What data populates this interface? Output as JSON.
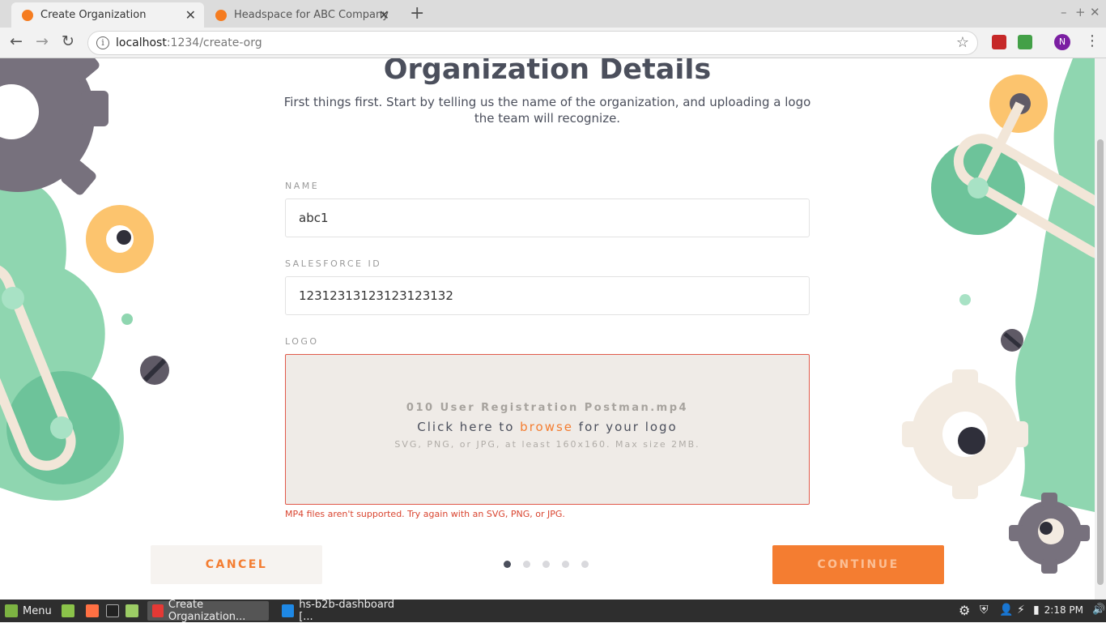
{
  "browser": {
    "tabs": [
      {
        "label": "Create Organization",
        "active": true
      },
      {
        "label": "Headspace for ABC Company",
        "active": false
      }
    ],
    "url_host": "localhost",
    "url_path": ":1234/create-org",
    "profile_initial": "N"
  },
  "page": {
    "title": "Organization Details",
    "subtitle": "First things first. Start by telling us the name of the organization, and uploading a logo the team will recognize.",
    "name_label": "NAME",
    "name_value": "abc1",
    "salesforce_label": "SALESFORCE ID",
    "salesforce_value": "12312313123123123132",
    "logo_label": "LOGO",
    "dropzone": {
      "file_name": "010 User Registration Postman.mp4",
      "prompt_before": "Click here to ",
      "prompt_link": "browse",
      "prompt_after": " for your logo",
      "hint": "SVG, PNG, or JPG, at least 160x160. Max size 2MB."
    },
    "error": "MP4 files aren't supported. Try again with an SVG, PNG, or JPG.",
    "cancel_label": "CANCEL",
    "continue_label": "CONTINUE",
    "step_total": 5,
    "step_current": 1
  },
  "taskbar": {
    "menu_label": "Menu",
    "windows": [
      "Create Organization...",
      "hs-b2b-dashboard [..."
    ],
    "clock": "2:18 PM"
  },
  "colors": {
    "accent": "#f47d31",
    "text_dark": "#4b4f5c",
    "error": "#d9442f",
    "green": "#8fd6b0",
    "gear_gray": "#77717d",
    "gear_yellow": "#fcc46e"
  }
}
